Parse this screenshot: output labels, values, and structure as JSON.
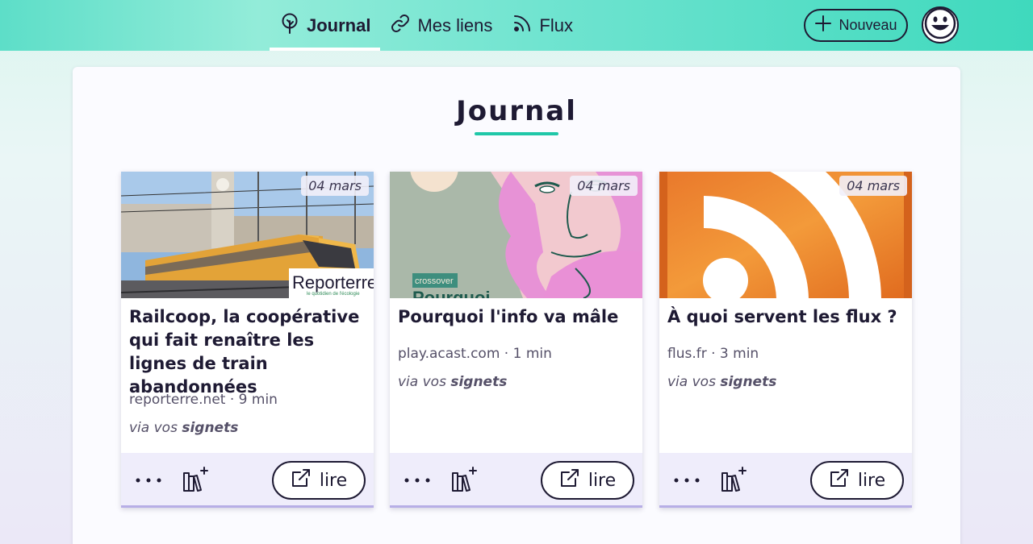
{
  "nav": {
    "items": [
      {
        "label": "Journal",
        "icon": "sprout-icon",
        "active": true
      },
      {
        "label": "Mes liens",
        "icon": "link-icon",
        "active": false
      },
      {
        "label": "Flux",
        "icon": "rss-icon",
        "active": false
      }
    ],
    "new_button": "Nouveau",
    "avatar_icon": "smiley-avatar-icon"
  },
  "page": {
    "title": "Journal"
  },
  "cards": [
    {
      "date": "04 mars",
      "title": "Railcoop, la coopérative qui fait renaître les lignes de train abandonnées",
      "meta": "reporterre.net · 9 min",
      "via_prefix": "via vos",
      "via_source": "signets",
      "image_logo": "Reporterre",
      "image_logo_tagline": "le quotidien de l'écologie",
      "read_label": "lire"
    },
    {
      "date": "04 mars",
      "title": "Pourquoi l'info va mâle",
      "meta": "play.acast.com · 1 min",
      "via_prefix": "via vos",
      "via_source": "signets",
      "image_tag": "crossover",
      "image_caption": "Pourquoi",
      "read_label": "lire"
    },
    {
      "date": "04 mars",
      "title": "À quoi servent les flux ?",
      "meta": "flus.fr · 3 min",
      "via_prefix": "via vos",
      "via_source": "signets",
      "read_label": "lire"
    }
  ],
  "colors": {
    "accent": "#1fc7a8",
    "header_start": "#5ddec8",
    "header_end": "#3fd9bd",
    "footer_bg": "#efedfb",
    "card_border": "#b7aee6"
  }
}
